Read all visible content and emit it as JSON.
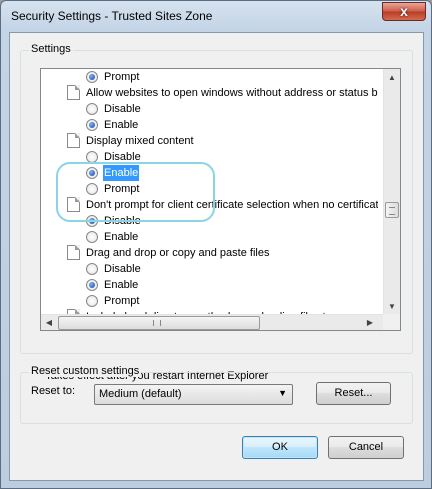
{
  "window": {
    "title": "Security Settings - Trusted Sites Zone",
    "close_glyph": "x"
  },
  "settings": {
    "group_label": "Settings",
    "rows": [
      {
        "kind": "radio",
        "label": "Prompt",
        "checked": true,
        "selected": false
      },
      {
        "kind": "group",
        "label": "Allow websites to open windows without address or status ba"
      },
      {
        "kind": "radio",
        "label": "Disable",
        "checked": false,
        "selected": false
      },
      {
        "kind": "radio",
        "label": "Enable",
        "checked": true,
        "selected": false
      },
      {
        "kind": "group",
        "label": "Display mixed content"
      },
      {
        "kind": "radio",
        "label": "Disable",
        "checked": false,
        "selected": false
      },
      {
        "kind": "radio",
        "label": "Enable",
        "checked": true,
        "selected": true
      },
      {
        "kind": "radio",
        "label": "Prompt",
        "checked": false,
        "selected": false
      },
      {
        "kind": "group",
        "label": "Don't prompt for client certificate selection when no certificat"
      },
      {
        "kind": "radio",
        "label": "Disable",
        "checked": true,
        "selected": false
      },
      {
        "kind": "radio",
        "label": "Enable",
        "checked": false,
        "selected": false
      },
      {
        "kind": "group",
        "label": "Drag and drop or copy and paste files"
      },
      {
        "kind": "radio",
        "label": "Disable",
        "checked": false,
        "selected": false
      },
      {
        "kind": "radio",
        "label": "Enable",
        "checked": true,
        "selected": false
      },
      {
        "kind": "radio",
        "label": "Prompt",
        "checked": false,
        "selected": false
      },
      {
        "kind": "group",
        "label": "Include local directory path when uploading files to a server"
      }
    ],
    "note": "*Takes effect after you restart Internet Explorer"
  },
  "reset": {
    "group_label": "Reset custom settings",
    "label": "Reset to:",
    "selected_value": "Medium (default)",
    "button_label": "Reset..."
  },
  "footer": {
    "ok_label": "OK",
    "cancel_label": "Cancel"
  },
  "icons": {
    "up": "▲",
    "down": "▼",
    "left": "◀",
    "right": "▶",
    "dropdown": "▼"
  },
  "colors": {
    "selection": "#3399ff",
    "annotation_outline": "#8ad4e6"
  }
}
